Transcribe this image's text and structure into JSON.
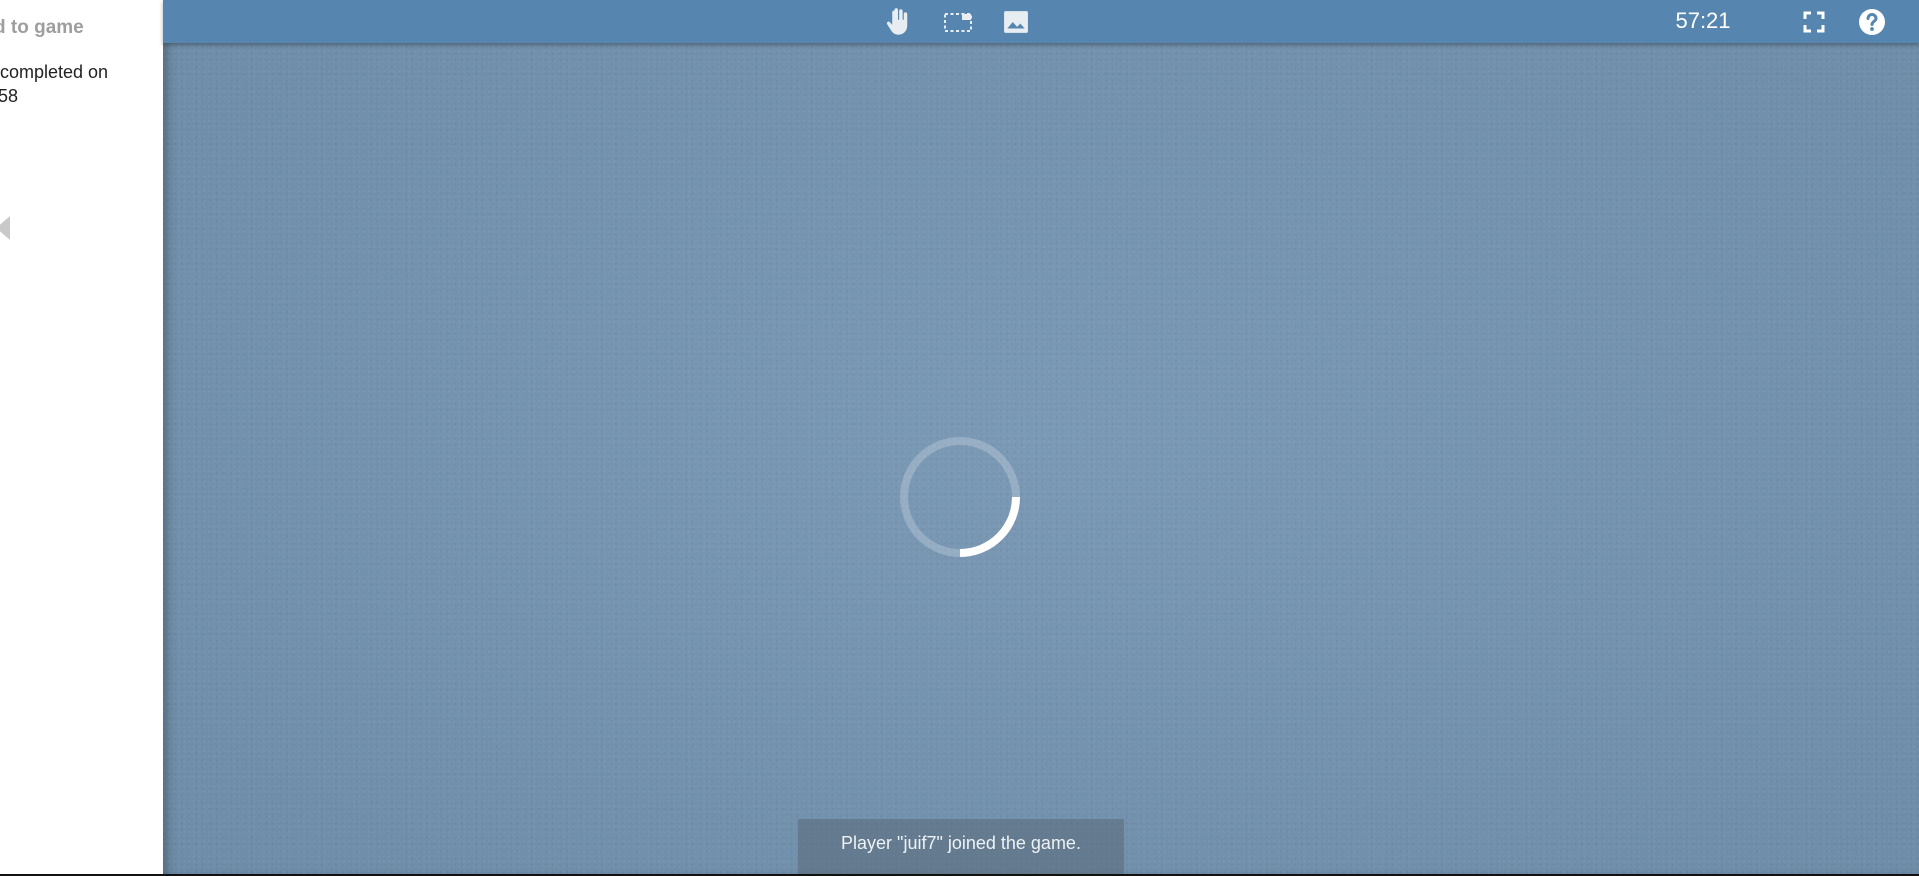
{
  "sidebar": {
    "title": "d to game",
    "line1": "completed on",
    "line2": "58"
  },
  "toolbar": {
    "tools": [
      {
        "icon": "hand-icon"
      },
      {
        "icon": "select-rectangle-icon"
      },
      {
        "icon": "image-icon"
      }
    ],
    "timer": "57:21",
    "fullscreen_icon": "fullscreen-icon",
    "help_icon": "help-icon"
  },
  "board": {
    "status": "loading",
    "spinner_icon": "loading-spinner-icon"
  },
  "toast": {
    "message": "Player \"juif7\" joined the game."
  },
  "colors": {
    "toolbar": "#5686b0",
    "board": "#7595b2",
    "sidebar": "#ffffff"
  }
}
